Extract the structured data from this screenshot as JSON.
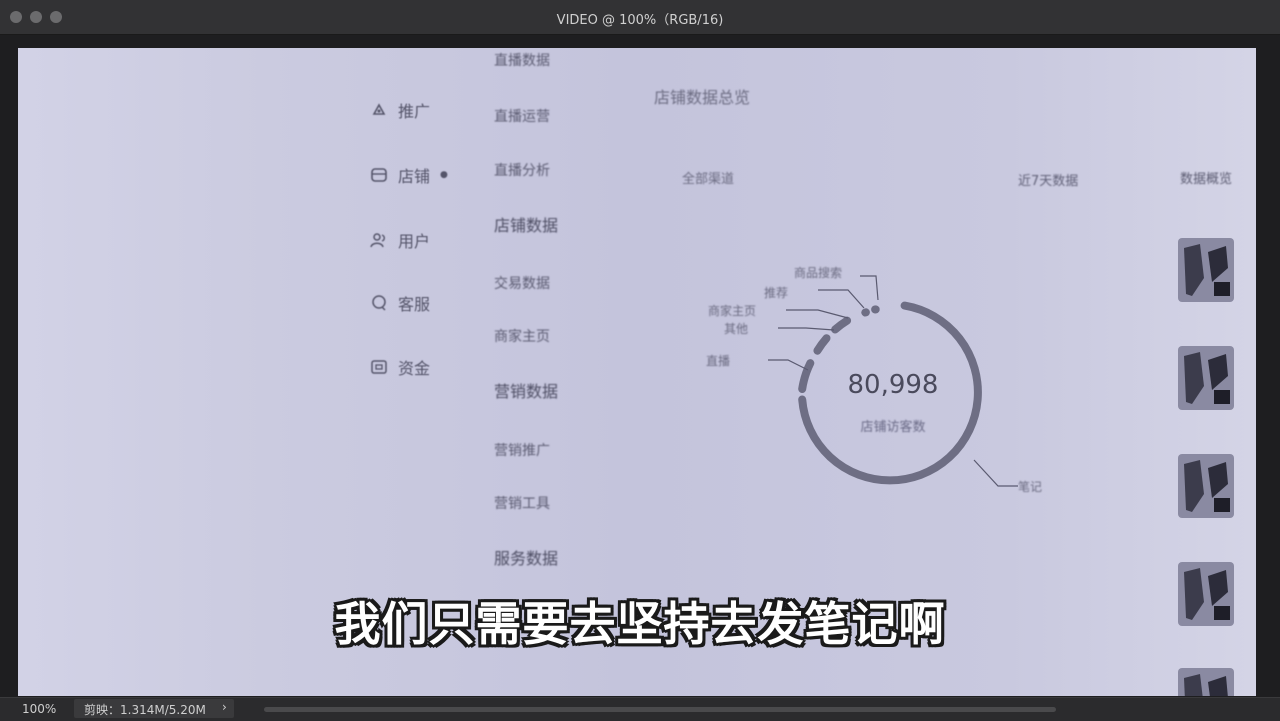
{
  "window": {
    "title": "VIDEO @ 100%（RGB/16)"
  },
  "sidebar": {
    "items": [
      {
        "label": "推广",
        "icon": "tag-icon"
      },
      {
        "label": "店铺",
        "icon": "store-icon"
      },
      {
        "label": "用户",
        "icon": "users-icon"
      },
      {
        "label": "客服",
        "icon": "chat-icon"
      },
      {
        "label": "资金",
        "icon": "wallet-icon"
      }
    ]
  },
  "submenu": {
    "items": [
      "直播数据",
      "直播运营",
      "直播分析",
      "店铺数据",
      "交易数据",
      "商家主页",
      "营销数据",
      "营销推广",
      "营销工具",
      "服务数据"
    ]
  },
  "main": {
    "section_title": "店铺数据总览",
    "filter_label": "全部渠道",
    "right_filter": "近7天数据",
    "right_top_label": "数据概览"
  },
  "donut": {
    "center_value": "80,998",
    "center_label": "店铺访客数",
    "labels": [
      "商品搜索",
      "推荐",
      "商家主页",
      "其他",
      "直播",
      "笔记"
    ]
  },
  "caption": {
    "text": "我们只需要去坚持去发笔记啊"
  },
  "status": {
    "zoom": "100%",
    "info": "剪映：1.314M/5.20M"
  },
  "colors": {
    "canvas": "#c9c9df",
    "ring": "#6e6e84",
    "caption_fill": "#ffffff",
    "caption_stroke": "#1a1a1a"
  }
}
